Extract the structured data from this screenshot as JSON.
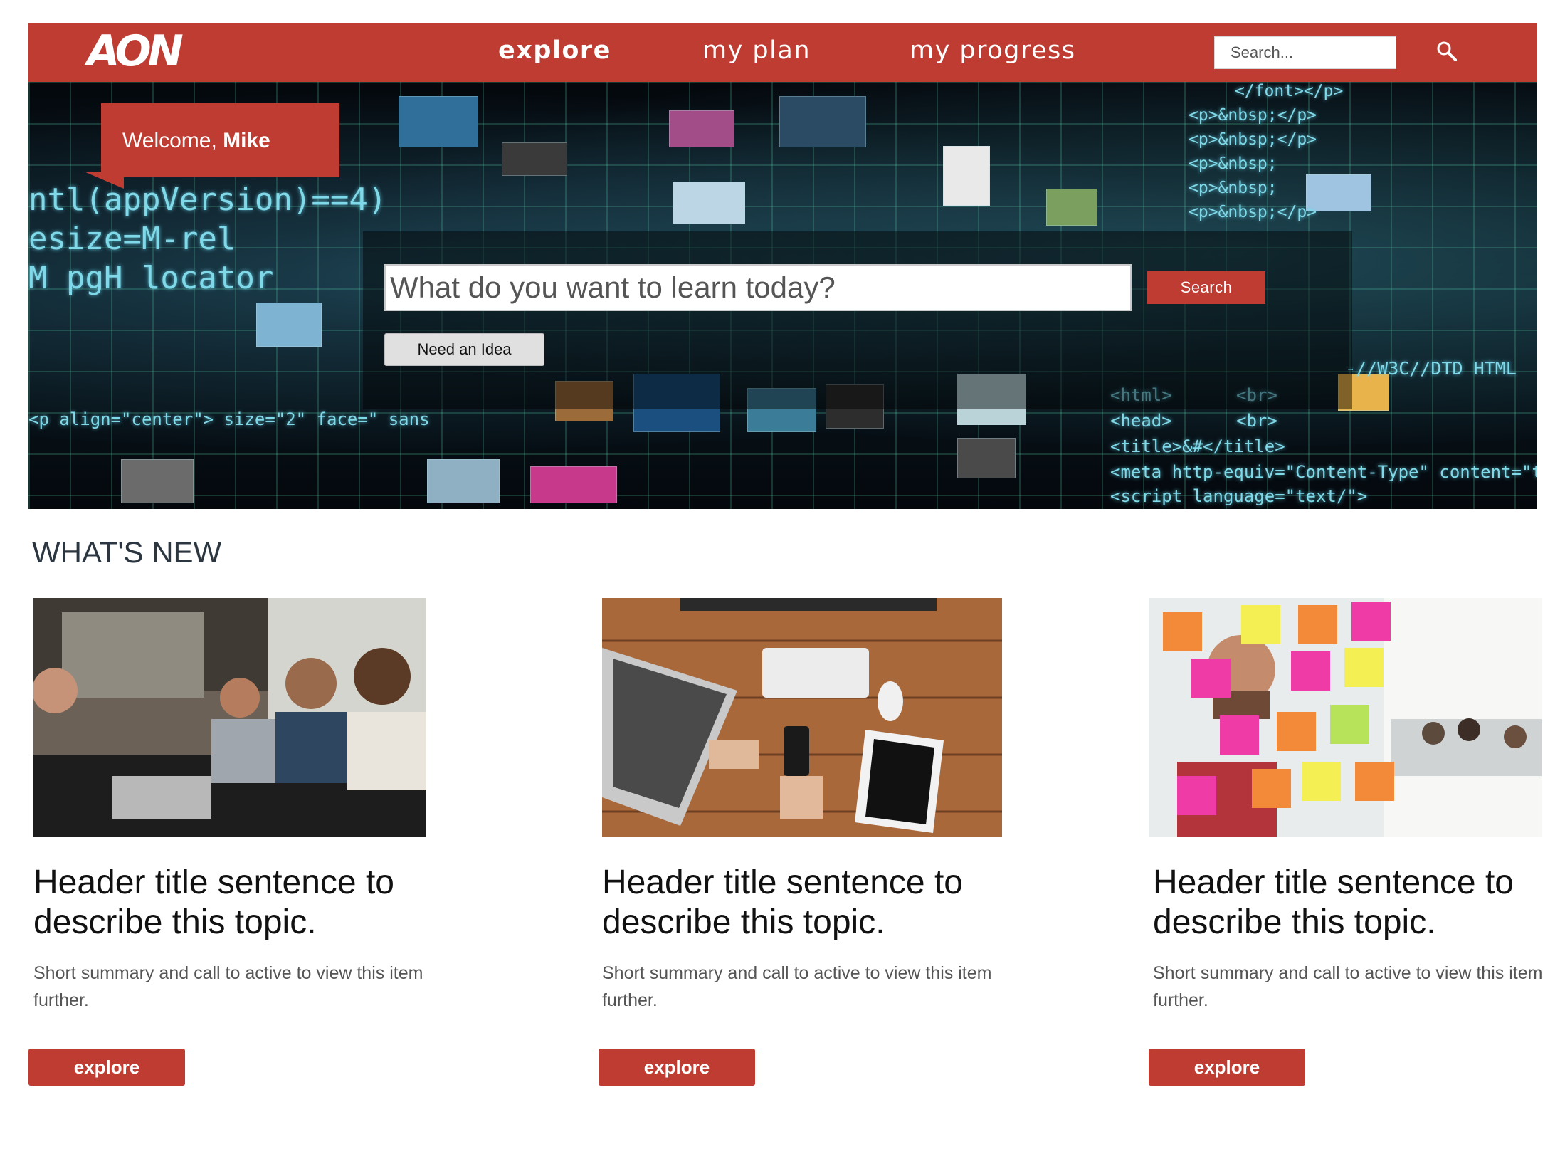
{
  "header": {
    "logo": "AON",
    "nav": [
      {
        "label": "explore",
        "active": true
      },
      {
        "label": "my plan",
        "active": false
      },
      {
        "label": "my progress",
        "active": false
      }
    ],
    "search_placeholder": "Search...",
    "search_icon": "magnifier-icon"
  },
  "hero": {
    "welcome_prefix": "Welcome, ",
    "welcome_name": "Mike",
    "search_placeholder": "What do you want to learn today?",
    "search_button": "Search",
    "idea_button": "Need an Idea",
    "code_snippets": [
      "ntl(appVersion)==4)",
      "esize=M-rel",
      "M pgH locator",
      "<p align=\"center\"> size=\"2\" face=\" sans",
      "</font></p>",
      "<p>&nbsp;</p>",
      "<p>&nbsp;</p>",
      "<p>&nbsp;",
      "<p>&nbsp;",
      "<p>&nbsp;</p>",
      "-//W3C//DTD HTML",
      "<html>",
      "<head>",
      "<br>",
      "<br>",
      "<title>&#</title>",
      "<meta http-equiv=\"Content-Type\" content=\"t",
      "<script language=\"text/\">"
    ]
  },
  "whats_new": {
    "title": "WHAT'S NEW",
    "cards": [
      {
        "image": "team-meeting-photo",
        "title": "Header title sentence to describe this topic.",
        "summary": "Short summary and call to active to view this item further.",
        "button": "explore"
      },
      {
        "image": "desk-laptop-photo",
        "title": "Header title sentence to describe this topic.",
        "summary": "Short summary and call to active to view this item further.",
        "button": "explore"
      },
      {
        "image": "sticky-notes-photo",
        "title": "Header title sentence to describe this topic.",
        "summary": "Short summary and call to active to view this item further.",
        "button": "explore"
      }
    ]
  },
  "colors": {
    "brand_red": "#bf3c33",
    "nav_text": "#ffffff",
    "heading": "#2b3640",
    "body_text": "#555555"
  }
}
